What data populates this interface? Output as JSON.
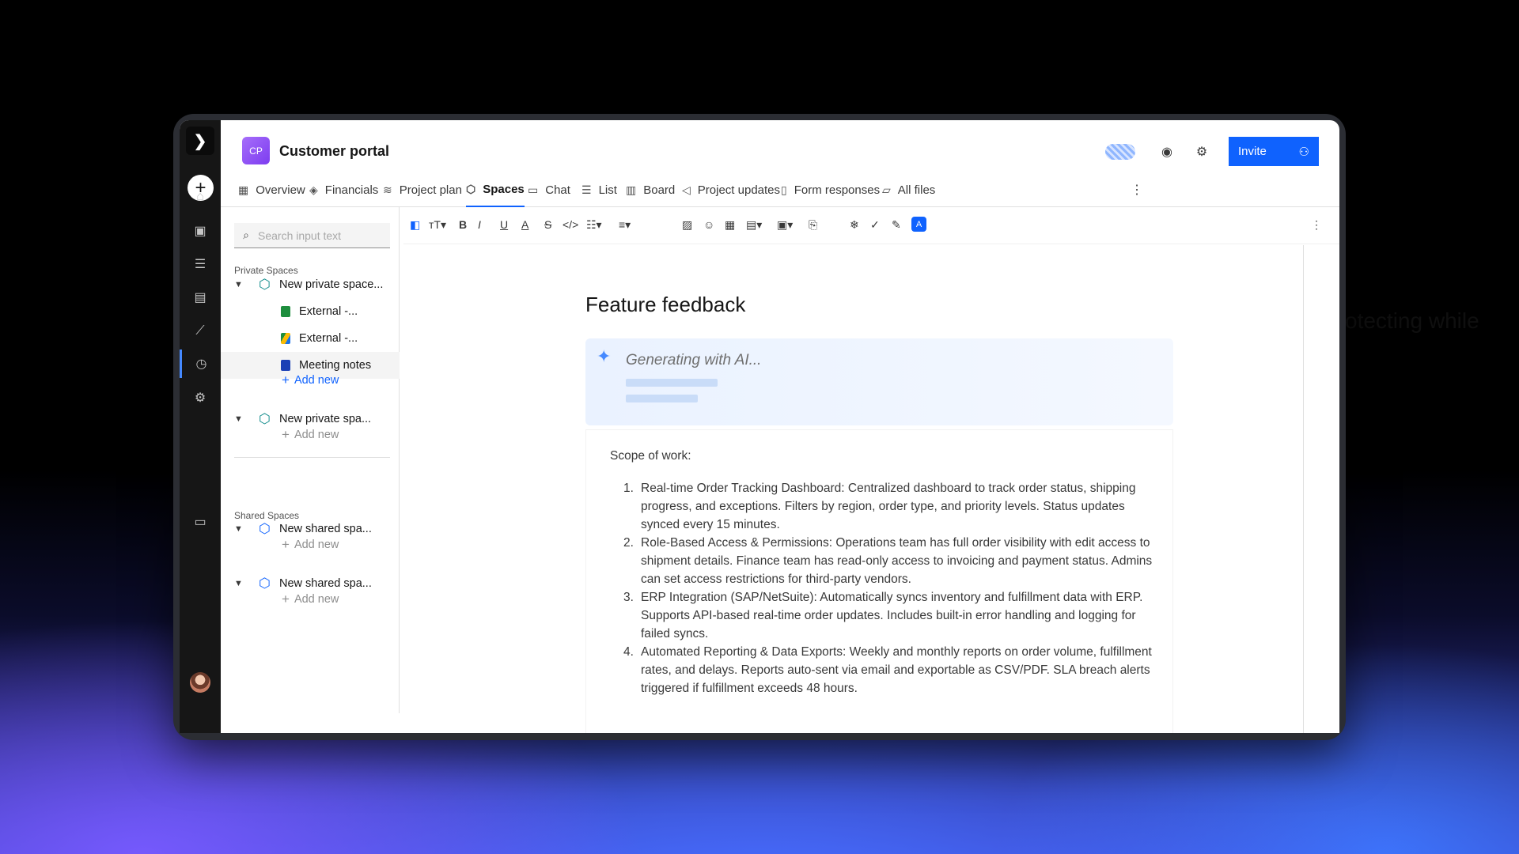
{
  "project": {
    "badge": "CP",
    "title": "Customer portal"
  },
  "header": {
    "invite_label": "Invite"
  },
  "tabs": [
    {
      "label": "Overview",
      "icon": "overview-icon"
    },
    {
      "label": "Financials",
      "icon": "financials-icon"
    },
    {
      "label": "Project plan",
      "icon": "project-plan-icon"
    },
    {
      "label": "Spaces",
      "icon": "spaces-icon",
      "active": true
    },
    {
      "label": "Chat",
      "icon": "chat-icon"
    },
    {
      "label": "List",
      "icon": "list-icon"
    },
    {
      "label": "Board",
      "icon": "board-icon"
    },
    {
      "label": "Project updates",
      "icon": "megaphone-icon"
    },
    {
      "label": "Form responses",
      "icon": "form-icon"
    },
    {
      "label": "All files",
      "icon": "folder-icon"
    }
  ],
  "sidebar": {
    "search_placeholder": "Search input text",
    "private_label": "Private Spaces",
    "shared_label": "Shared Spaces",
    "private_spaces": [
      {
        "name": "New private space...",
        "children": [
          {
            "name": "External -...",
            "icon": "sheets-icon",
            "color": "#1e8e3e"
          },
          {
            "name": "External -...",
            "icon": "drive-icon",
            "color": "#fbbc04"
          },
          {
            "name": "Meeting notes",
            "icon": "doc-icon",
            "color": "#1a3fb5",
            "selected": true
          }
        ],
        "add_label": "Add new"
      },
      {
        "name": "New private spa...",
        "children": [],
        "add_label": "Add new"
      }
    ],
    "shared_spaces": [
      {
        "name": "New shared spa...",
        "add_label": "Add new"
      },
      {
        "name": "New shared spa...",
        "add_label": "Add new"
      }
    ]
  },
  "document": {
    "title": "Feature feedback",
    "ai_status": "Generating with AI...",
    "scope_label": "Scope of work:",
    "items": [
      {
        "n": "1.",
        "text": "Real-time Order Tracking Dashboard: Centralized dashboard to track order status, shipping progress, and exceptions. Filters by region, order type, and priority levels. Status updates synced every 15 minutes."
      },
      {
        "n": "2.",
        "text": "Role-Based Access & Permissions: Operations team has full order visibility with edit access to shipment details. Finance team has read-only access to invoicing and payment status. Admins can set access restrictions for third-party vendors."
      },
      {
        "n": "3.",
        "text": "ERP Integration (SAP/NetSuite): Automatically syncs inventory and fulfillment data with ERP. Supports API-based real-time order updates. Includes built-in error handling and logging for failed syncs."
      },
      {
        "n": "4.",
        "text": "Automated Reporting & Data Exports: Weekly and monthly reports on order volume, fulfillment rates, and delays. Reports auto-sent via email and exportable as CSV/PDF. SLA breach alerts triggered if fulfillment exceeds 48 hours."
      }
    ]
  },
  "background_text": "otecting while",
  "colors": {
    "accent": "#0f62fe",
    "rail": "#161616",
    "ai_bg": "#eaf2ff"
  }
}
